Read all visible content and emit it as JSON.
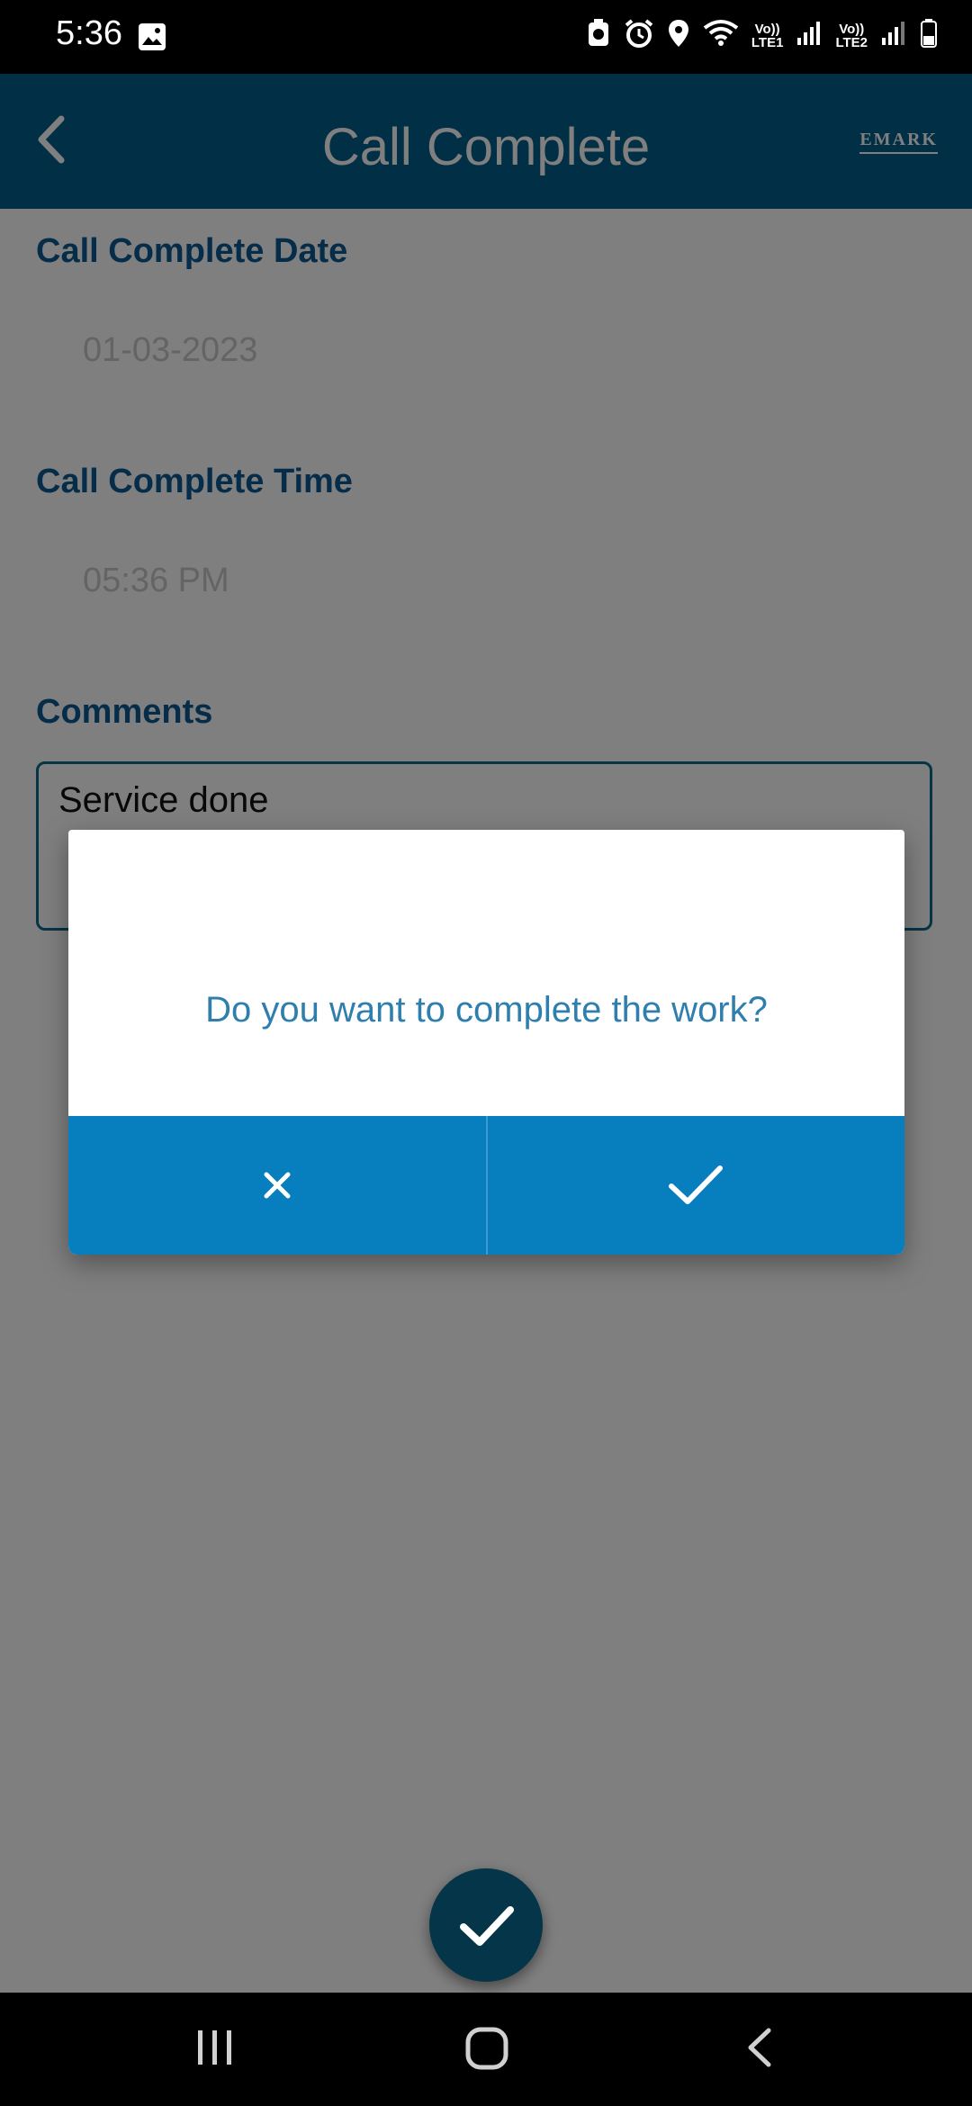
{
  "status_bar": {
    "time": "5:36",
    "network": {
      "sim1_top": "Vo))",
      "sim1_bottom": "LTE1",
      "sim2_top": "Vo))",
      "sim2_bottom": "LTE2"
    }
  },
  "app_bar": {
    "title": "Call Complete",
    "logo_text": "EMARK"
  },
  "form": {
    "date_label": "Call Complete Date",
    "date_value": "01-03-2023",
    "time_label": "Call Complete Time",
    "time_value": "05:36 PM",
    "comments_label": "Comments",
    "comments_value": "Service done"
  },
  "dialog": {
    "message": "Do you want to complete the work?",
    "cancel_icon": "close-icon",
    "confirm_icon": "check-icon"
  },
  "fab": {
    "icon": "check-icon"
  },
  "colors": {
    "app_bar": "#035f8a",
    "label": "#0b5a92",
    "dialog_button": "#077ebd",
    "dialog_text": "#2f7fae"
  }
}
